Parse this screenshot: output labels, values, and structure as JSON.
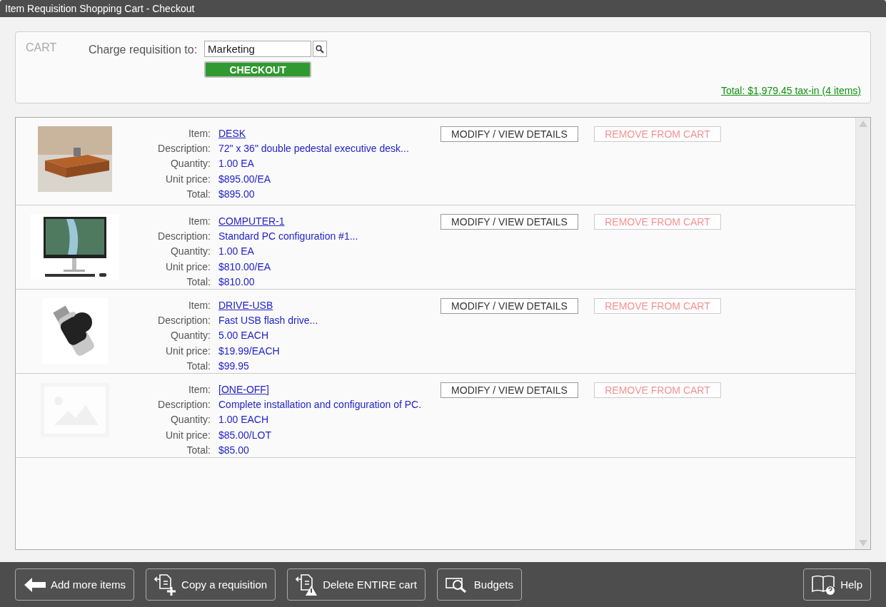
{
  "window": {
    "title": "Item Requisition Shopping Cart - Checkout"
  },
  "cart": {
    "heading": "CART",
    "charge_label": "Charge requisition to:",
    "charge_value": "Marketing",
    "checkout": "CHECKOUT",
    "total": "Total: $1,979.45 tax-in (4 items)"
  },
  "items": [
    {
      "kind": "desk",
      "fields": [
        {
          "kind": "link",
          "label": "Item:",
          "value": "DESK"
        },
        {
          "kind": "text",
          "label": "Description:",
          "value": "72\" x 36\" double pedestal executive desk..."
        },
        {
          "kind": "text",
          "label": "Quantity:",
          "value": "1.00 EA"
        },
        {
          "kind": "text",
          "label": "Unit price:",
          "value": "$895.00/EA"
        },
        {
          "kind": "text",
          "label": "Total:",
          "value": "$895.00"
        }
      ],
      "modify": "MODIFY / VIEW DETAILS",
      "remove": "REMOVE FROM CART"
    },
    {
      "kind": "computer",
      "fields": [
        {
          "kind": "link",
          "label": "Item:",
          "value": "COMPUTER-1"
        },
        {
          "kind": "text",
          "label": "Description:",
          "value": "Standard PC configuration #1..."
        },
        {
          "kind": "text",
          "label": "Quantity:",
          "value": "1.00 EA"
        },
        {
          "kind": "text",
          "label": "Unit price:",
          "value": "$810.00/EA"
        },
        {
          "kind": "text",
          "label": "Total:",
          "value": "$810.00"
        }
      ],
      "modify": "MODIFY / VIEW DETAILS",
      "remove": "REMOVE FROM CART"
    },
    {
      "kind": "usb",
      "fields": [
        {
          "kind": "link",
          "label": "Item:",
          "value": "DRIVE-USB"
        },
        {
          "kind": "text",
          "label": "Description:",
          "value": "Fast USB flash drive..."
        },
        {
          "kind": "text",
          "label": "Quantity:",
          "value": "5.00 EACH"
        },
        {
          "kind": "text",
          "label": "Unit price:",
          "value": "$19.99/EACH"
        },
        {
          "kind": "text",
          "label": "Total:",
          "value": "$99.95"
        }
      ],
      "modify": "MODIFY / VIEW DETAILS",
      "remove": "REMOVE FROM CART"
    },
    {
      "kind": "none",
      "fields": [
        {
          "kind": "link",
          "label": "Item:",
          "value": "[ONE-OFF]"
        },
        {
          "kind": "text",
          "label": "Description:",
          "value": "Complete installation and configuration of PC."
        },
        {
          "kind": "text",
          "label": "Quantity:",
          "value": "1.00 EACH"
        },
        {
          "kind": "text",
          "label": "Unit price:",
          "value": "$85.00/LOT"
        },
        {
          "kind": "text",
          "label": "Total:",
          "value": "$85.00"
        }
      ],
      "modify": "MODIFY / VIEW DETAILS",
      "remove": "REMOVE FROM CART"
    }
  ],
  "footer": [
    {
      "kind": "back",
      "label": "Add more items"
    },
    {
      "kind": "copy",
      "label": "Copy a requisition"
    },
    {
      "kind": "delete",
      "label": "Delete ENTIRE cart"
    },
    {
      "kind": "budgets",
      "label": "Budgets"
    },
    {
      "kind": "help",
      "label": "Help"
    }
  ]
}
